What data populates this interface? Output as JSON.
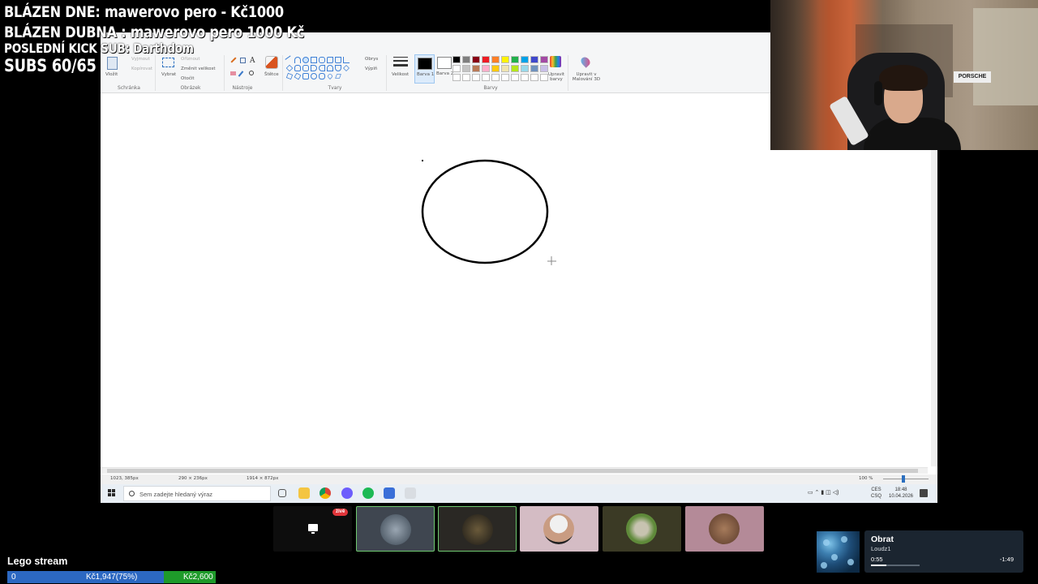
{
  "overlay": {
    "line1": "BLÁZEN DNE: mawerovo pero - Kč1000",
    "line2": "BLÁZEN DUBNA : mawerovo pero 1000 Kč",
    "line3": "POSLEDNÍ KICK SUB: Darthdom",
    "line4": "SUBS 60/65"
  },
  "paint": {
    "ribbon_groups": [
      {
        "label": "Schránka"
      },
      {
        "label": "Obrázek"
      },
      {
        "label": "Nástroje"
      },
      {
        "label": "Tvary"
      },
      {
        "label": "Barvy"
      }
    ],
    "clipboard": {
      "paste": "Vložit",
      "cut": "Vyjmout",
      "copy": "Kopírovat"
    },
    "image": {
      "select": "Vybrat",
      "crop": "Oříznout",
      "resize": "Změnit velikost",
      "rotate": "Otočit"
    },
    "brushes": "Štětce",
    "outline": "Obrys",
    "fill": "Výplň",
    "size": "Velikost",
    "colour1": "Barva 1",
    "colour2": "Barva 2",
    "edit_colours": "Upravit barvy",
    "edit_paint3d": "Upravit v Malování 3D",
    "palette": [
      "#000000",
      "#7f7f7f",
      "#880015",
      "#ed1c24",
      "#ff7f27",
      "#fff200",
      "#22b14c",
      "#00a2e8",
      "#3f48cc",
      "#a349a4",
      "#ffffff",
      "#c3c3c3",
      "#b97a57",
      "#ffaec9",
      "#ffc90e",
      "#efe4b0",
      "#b5e61d",
      "#99d9ea",
      "#7092be",
      "#c8bfe7",
      "#ffffff",
      "#ffffff",
      "#ffffff",
      "#ffffff",
      "#ffffff",
      "#ffffff",
      "#ffffff",
      "#ffffff",
      "#ffffff",
      "#ffffff"
    ],
    "status": {
      "cursor": "1023, 385px",
      "selection": "290 × 236px",
      "canvas_size": "1914 × 872px",
      "zoom": "100 %"
    }
  },
  "taskbar": {
    "search_placeholder": "Sem zadejte hledaný výraz",
    "lang": "CES",
    "layout": "CSQ",
    "time": "18:48",
    "date": "10.04.2026"
  },
  "thumbnails": {
    "live_badge": "živě",
    "colors": [
      "#0d0d0d",
      "#3f4650",
      "#2a2824",
      "#d4bcc4",
      "#3b3a25",
      "#b48a98"
    ]
  },
  "goal": {
    "title": "Lego stream",
    "start": "0",
    "current": "Kč1,947(75%)",
    "target": "Kč2,600",
    "progress": 0.75
  },
  "now_playing": {
    "title": "Obrat",
    "artist": "Loudz1",
    "elapsed": "0:55",
    "remaining": "-1:49",
    "progress": 0.31
  },
  "webcam": {
    "sign_text": "PORSCHE"
  }
}
